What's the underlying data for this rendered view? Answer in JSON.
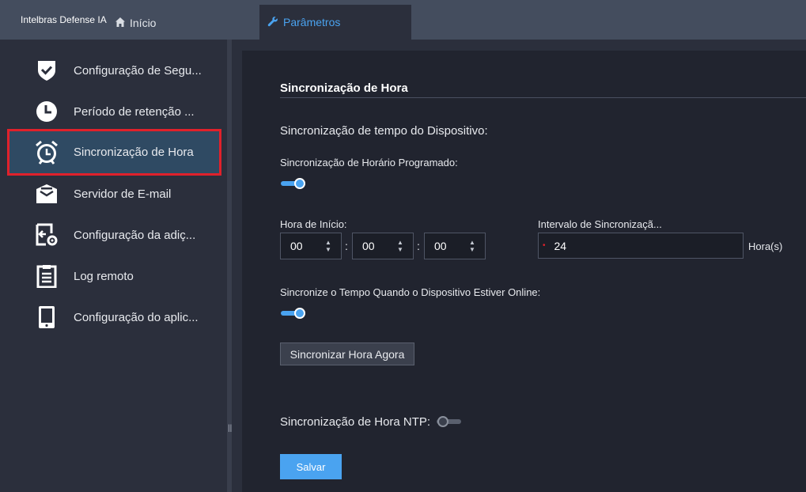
{
  "header": {
    "app_title": "Intelbras Defense IA",
    "home_label": "Início",
    "active_tab_label": "Parâmetros"
  },
  "sidebar": {
    "items": [
      {
        "icon": "shield-check-icon",
        "label": "Configuração de Segu..."
      },
      {
        "icon": "clock-icon",
        "label": "Período de retenção ..."
      },
      {
        "icon": "alarm-clock-icon",
        "label": "Sincronização de Hora",
        "active": true
      },
      {
        "icon": "email-icon",
        "label": "Servidor de E-mail"
      },
      {
        "icon": "import-settings-icon",
        "label": "Configuração da adiç..."
      },
      {
        "icon": "clipboard-icon",
        "label": "Log remoto"
      },
      {
        "icon": "tablet-icon",
        "label": "Configuração do aplic..."
      }
    ],
    "splitter_grip": "||"
  },
  "main": {
    "section_title": "Sincronização de Hora",
    "device_sync_label": "Sincronização de tempo do Dispositivo:",
    "scheduled_sync_label": "Sincronização de Horário Programado:",
    "scheduled_sync_enabled": true,
    "start_time_label": "Hora de Início:",
    "start_time": {
      "hour": "00",
      "minute": "00",
      "second": "00"
    },
    "time_separator": ":",
    "interval_label": "Intervalo de Sincronizaçã...",
    "interval_required_mark": "•",
    "interval_value": "24",
    "interval_unit": "Hora(s)",
    "online_sync_label": "Sincronize o Tempo Quando o Dispositivo Estiver Online:",
    "online_sync_enabled": true,
    "sync_now_button": "Sincronizar Hora Agora",
    "ntp_label": "Sincronização de Hora NTP:",
    "ntp_enabled": false,
    "save_button": "Salvar"
  },
  "colors": {
    "accent": "#4aa3f0",
    "active_highlight_border": "#e0212b",
    "topbar": "#444d5e",
    "panel": "#21242f"
  }
}
